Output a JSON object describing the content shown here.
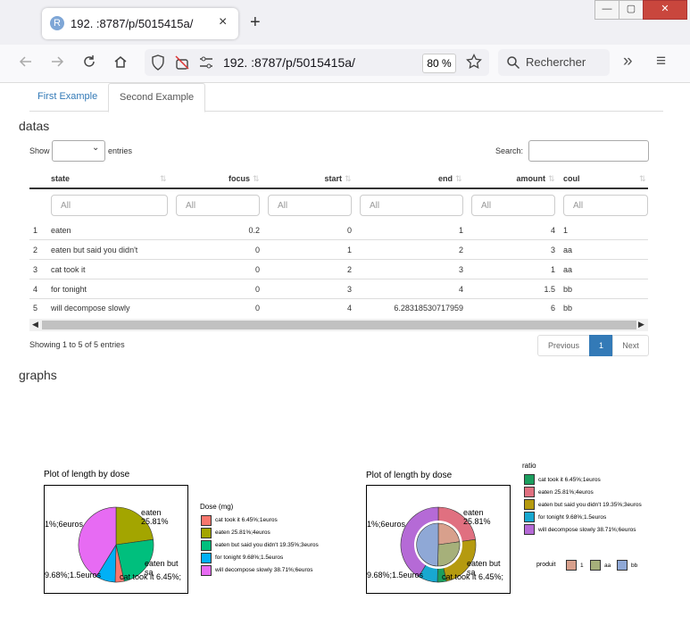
{
  "browser": {
    "tab_favicon_letter": "R",
    "tab_title": "192.                    :8787/p/5015415a/",
    "tab_close": "×",
    "new_tab": "+",
    "window_controls": [
      "—",
      "▢",
      "✕"
    ],
    "nav_icons": [
      "back-icon",
      "forward-icon",
      "reload-icon",
      "home-icon",
      "shield-icon",
      "no-media-icon",
      "permissions-icon"
    ],
    "url": "192.                    :8787/p/5015415a/",
    "zoom": "80 %",
    "search_placeholder": "Rechercher",
    "overflow": "»",
    "menu": "≡"
  },
  "page_tabs": [
    "First Example",
    "Second Example"
  ],
  "datas": {
    "title": "datas",
    "show_label": "Show",
    "entries_label": "entries",
    "search_label": "Search:",
    "columns": [
      "state",
      "focus",
      "start",
      "end",
      "amount",
      "coul"
    ],
    "filter_placeholder": "All",
    "rows": [
      {
        "idx": "1",
        "state": "eaten",
        "focus": "0.2",
        "start": "0",
        "end": "1",
        "amount": "4",
        "coul": "1"
      },
      {
        "idx": "2",
        "state": "eaten but said you didn't",
        "focus": "0",
        "start": "1",
        "end": "2",
        "amount": "3",
        "coul": "aa"
      },
      {
        "idx": "3",
        "state": "cat took it",
        "focus": "0",
        "start": "2",
        "end": "3",
        "amount": "1",
        "coul": "aa"
      },
      {
        "idx": "4",
        "state": "for tonight",
        "focus": "0",
        "start": "3",
        "end": "4",
        "amount": "1.5",
        "coul": "bb"
      },
      {
        "idx": "5",
        "state": "will decompose slowly",
        "focus": "0",
        "start": "4",
        "end": "6.28318530717959",
        "amount": "6",
        "coul": "bb"
      }
    ],
    "info": "Showing 1 to 5 of 5 entries",
    "pagination": {
      "previous": "Previous",
      "current": "1",
      "next": "Next"
    }
  },
  "graphs": {
    "title": "graphs",
    "chart1": {
      "title": "Plot of length by dose",
      "legend_title": "Dose (mg)",
      "legend": [
        {
          "label": "cat took it 6.45%;1euros",
          "color": "#f8766d"
        },
        {
          "label": "eaten 25.81%;4euros",
          "color": "#a3a500"
        },
        {
          "label": "eaten but said you didn't 19.35%;3euros",
          "color": "#00bf7d"
        },
        {
          "label": "for tonight 9.68%;1.5euros",
          "color": "#00b0f6"
        },
        {
          "label": "will decompose slowly 38.71%;6euros",
          "color": "#e76bf3"
        }
      ],
      "labels": [
        "eaten 25.81%",
        "1%;6euros",
        "9.68%;1.5euros",
        "eaten but sa",
        "cat took it 6.45%;"
      ]
    },
    "chart2": {
      "title": "Plot of length by dose",
      "legend_title": "ratio",
      "legend": [
        {
          "label": "cat took it 6.45%;1euros",
          "color": "#1b9e5e"
        },
        {
          "label": "eaten 25.81%;4euros",
          "color": "#e07080"
        },
        {
          "label": "eaten but said you didn't 19.35%;3euros",
          "color": "#b59a0f"
        },
        {
          "label": "for tonight 9.68%;1.5euros",
          "color": "#18a8d0"
        },
        {
          "label": "will decompose slowly 38.71%;6euros",
          "color": "#b56ad6"
        }
      ],
      "legend2_title": "produit",
      "legend2": [
        {
          "label": "1",
          "color": "#d8a08c"
        },
        {
          "label": "aa",
          "color": "#a6b07a"
        },
        {
          "label": "bb",
          "color": "#8fa8d6"
        }
      ],
      "labels": [
        "eaten 25.81%",
        "1%;6euros",
        "9.68%;1.5euros",
        "eaten but sa",
        "cat took it 6.45%;"
      ]
    }
  }
}
